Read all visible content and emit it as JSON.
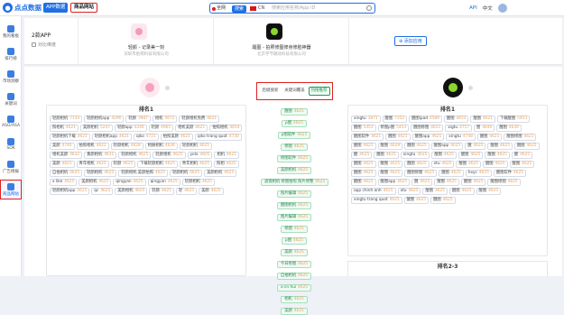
{
  "topbar": {
    "logo_text": "点点数据",
    "nav_app": "APP数据",
    "nav_product": "商品网站",
    "search_scope": "全网",
    "search_button": "搜索",
    "search_country_code": "CN",
    "search_placeholder": "搜索应用名称/App ID",
    "api_label": "API",
    "lang_label": "中文"
  },
  "sidebar": {
    "items": [
      {
        "label": "我的看板",
        "icon": "dashboard-icon"
      },
      {
        "label": "排行榜",
        "icon": "ranking-icon"
      },
      {
        "label": "市场洞察",
        "icon": "market-icon"
      },
      {
        "label": "关键词",
        "icon": "keyword-icon"
      },
      {
        "label": "ASO/ASA",
        "icon": "aso-icon"
      },
      {
        "label": "SDK",
        "icon": "sdk-icon"
      },
      {
        "label": "广告情报",
        "icon": "ad-icon"
      },
      {
        "label": "商品网站",
        "icon": "shop-icon"
      }
    ]
  },
  "compare": {
    "left_title": "2款APP",
    "left_sub": "对比维度",
    "app_a": {
      "name": "轻颜 - 记录美一刻",
      "sub": "深圳市脸萌科技有限公司"
    },
    "app_b": {
      "name": "醒图 - 拍照修图修身修脸神器",
      "sub": "北京字节跳动科技有限公司"
    },
    "add_label": "添加应用"
  },
  "tabs": [
    "后缀搜索",
    "关键词覆盖",
    "热搜推荐"
  ],
  "left_panel": {
    "header": "排名1",
    "chips": [
      {
        "t": "轻颜相机",
        "v": "7134"
      },
      {
        "t": "轻颜相机app",
        "v": "4296"
      },
      {
        "t": "轻颜",
        "v": "3987"
      },
      {
        "t": "相机",
        "v": "4672"
      },
      {
        "t": "轻颜相机免费",
        "v": "4621"
      },
      {
        "t": "照相机",
        "v": "4621"
      },
      {
        "t": "美颜相机",
        "v": "5247"
      },
      {
        "t": "轻颜app",
        "v": "4246"
      },
      {
        "t": "轻颜",
        "v": "4965"
      },
      {
        "t": "相机美颜",
        "v": "4621"
      },
      {
        "t": "拍照相机",
        "v": "4654"
      },
      {
        "t": "轻颜相机下载",
        "v": "4621"
      },
      {
        "t": "轻颜相机app",
        "v": "4621"
      },
      {
        "t": "qiko",
        "v": "4721"
      },
      {
        "t": "拍照美颜",
        "v": "4621"
      },
      {
        "t": "qiko trang quot",
        "v": "4730"
      },
      {
        "t": "美颜",
        "v": "4740"
      },
      {
        "t": "拍照相机",
        "v": "4622"
      },
      {
        "t": "轻颜相机",
        "v": "4628"
      },
      {
        "t": "相册相机",
        "v": "4636"
      },
      {
        "t": "轻颜相机",
        "v": "4625"
      },
      {
        "t": "相机美颜",
        "v": "4632"
      },
      {
        "t": "素颜相机",
        "v": "4631"
      },
      {
        "t": "轻颜相机",
        "v": "4625"
      },
      {
        "t": "轻颜相机",
        "v": "4625"
      },
      {
        "t": "yolo",
        "v": "4605"
      },
      {
        "t": "相机",
        "v": "4621"
      },
      {
        "t": "美颜",
        "v": "4621"
      },
      {
        "t": "青年相机",
        "v": "4625"
      },
      {
        "t": "轻颜",
        "v": "4625"
      },
      {
        "t": "下载轻颜相机",
        "v": "4625"
      },
      {
        "t": "青年相机",
        "v": "4625"
      },
      {
        "t": "照相",
        "v": "4625"
      },
      {
        "t": "自拍相机",
        "v": "4625"
      },
      {
        "t": "轻颜相机",
        "v": "4625"
      },
      {
        "t": "轻颜相机·美颜拍照",
        "v": "4625"
      },
      {
        "t": "轻颜相机",
        "v": "4625"
      },
      {
        "t": "美颜相机",
        "v": "4625"
      },
      {
        "t": "x like",
        "v": "4625"
      },
      {
        "t": "美颜相机",
        "v": "4625"
      },
      {
        "t": "qingyan",
        "v": "4625"
      },
      {
        "t": "qingyan",
        "v": "4625"
      },
      {
        "t": "轻颜相机",
        "v": "4625"
      },
      {
        "t": "轻颜相机app",
        "v": "4625"
      },
      {
        "t": "qc",
        "v": "4625"
      },
      {
        "t": "美颜相机",
        "v": "4625"
      },
      {
        "t": "轻颜",
        "v": "4625"
      },
      {
        "t": "轻",
        "v": "4625"
      },
      {
        "t": "美颜",
        "v": "4625"
      }
    ]
  },
  "middle": {
    "chips": [
      {
        "t": "醒图",
        "v": "4625"
      },
      {
        "t": "p图",
        "v": "4625"
      },
      {
        "t": "p图软件",
        "v": "4625"
      },
      {
        "t": "修图",
        "v": "4625"
      },
      {
        "t": "修图软件",
        "v": "4625"
      },
      {
        "t": "美颜相机",
        "v": "4625"
      },
      {
        "t": "滤镜相机 修图拍照 照片修整",
        "v": "4625"
      },
      {
        "t": "照片编辑",
        "v": "4625"
      },
      {
        "t": "醒图相机",
        "v": "4625"
      },
      {
        "t": "图片编辑",
        "v": "4625"
      },
      {
        "t": "修图",
        "v": "4625"
      },
      {
        "t": "p图",
        "v": "4625"
      },
      {
        "t": "美颜",
        "v": "4625"
      },
      {
        "t": "今日修图",
        "v": "4625"
      },
      {
        "t": "自拍相机",
        "v": "4625"
      },
      {
        "t": "x-cn hui",
        "v": "4625"
      },
      {
        "t": "相机",
        "v": "4625"
      },
      {
        "t": "美颜",
        "v": "4625"
      }
    ]
  },
  "right_panel": {
    "header": "排名1",
    "chips": [
      {
        "t": "xingtu",
        "v": "3871"
      },
      {
        "t": "醒图",
        "v": "7352"
      },
      {
        "t": "醒图ipad",
        "v": "4589"
      },
      {
        "t": "醒图",
        "v": "4653"
      },
      {
        "t": "醒图",
        "v": "4621"
      },
      {
        "t": "下载醒图",
        "v": "5453"
      },
      {
        "t": "醒图",
        "v": "5453"
      },
      {
        "t": "修图p图",
        "v": "5453"
      },
      {
        "t": "醒图修图",
        "v": "4621"
      },
      {
        "t": "xigtu",
        "v": "4757"
      },
      {
        "t": "图",
        "v": "4640"
      },
      {
        "t": "醒图",
        "v": "4639"
      },
      {
        "t": "醒图软件",
        "v": "4621"
      },
      {
        "t": "醒图",
        "v": "4621"
      },
      {
        "t": "醒图app",
        "v": "4621"
      },
      {
        "t": "xingtu",
        "v": "4748"
      },
      {
        "t": "醒图",
        "v": "4621"
      },
      {
        "t": "醒图修图",
        "v": "4621"
      },
      {
        "t": "醒图",
        "v": "4625"
      },
      {
        "t": "醒图",
        "v": "4629"
      },
      {
        "t": "醒图",
        "v": "4625"
      },
      {
        "t": "醒图app",
        "v": "4625"
      },
      {
        "t": "醒",
        "v": "4625"
      },
      {
        "t": "醒图",
        "v": "4625"
      },
      {
        "t": "醒图",
        "v": "4625"
      },
      {
        "t": "醒",
        "v": "4625"
      },
      {
        "t": "醒图",
        "v": "4625"
      },
      {
        "t": "xingtu",
        "v": "4625"
      },
      {
        "t": "醒图",
        "v": "4625"
      },
      {
        "t": "醒图",
        "v": "4625"
      },
      {
        "t": "醒图",
        "v": "4625"
      },
      {
        "t": "醒",
        "v": "4625"
      },
      {
        "t": "醒图",
        "v": "4625"
      },
      {
        "t": "醒图",
        "v": "4625"
      },
      {
        "t": "醒图",
        "v": "4625"
      },
      {
        "t": "xtu",
        "v": "4625"
      },
      {
        "t": "醒图",
        "v": "4625"
      },
      {
        "t": "醒图",
        "v": "4625"
      },
      {
        "t": "醒图",
        "v": "4625"
      },
      {
        "t": "醒图",
        "v": "4625"
      },
      {
        "t": "醒图",
        "v": "4625"
      },
      {
        "t": "醒图修图",
        "v": "4625"
      },
      {
        "t": "醒图",
        "v": "4625"
      },
      {
        "t": "hxyc",
        "v": "4625"
      },
      {
        "t": "醒图软件",
        "v": "4625"
      },
      {
        "t": "醒图",
        "v": "4625"
      },
      {
        "t": "醒图app",
        "v": "4625"
      },
      {
        "t": "醒",
        "v": "4625"
      },
      {
        "t": "醒图",
        "v": "4625"
      },
      {
        "t": "醒图",
        "v": "4625"
      },
      {
        "t": "醒图修图",
        "v": "4625"
      },
      {
        "t": "app chinh anh",
        "v": "4625"
      },
      {
        "t": "xtu",
        "v": "4625"
      },
      {
        "t": "醒图",
        "v": "4625"
      },
      {
        "t": "醒图",
        "v": "4625"
      },
      {
        "t": "醒图",
        "v": "4625"
      },
      {
        "t": "xingtu trang quot",
        "v": "4625"
      },
      {
        "t": "醒图",
        "v": "4625"
      },
      {
        "t": "醒图",
        "v": "4625"
      }
    ],
    "sub_header": "排名2-3"
  },
  "colors": {
    "accent": "#1f6fe5",
    "highlight": "#e02020",
    "green": "#1a9e57",
    "value": "#e9a15c"
  }
}
